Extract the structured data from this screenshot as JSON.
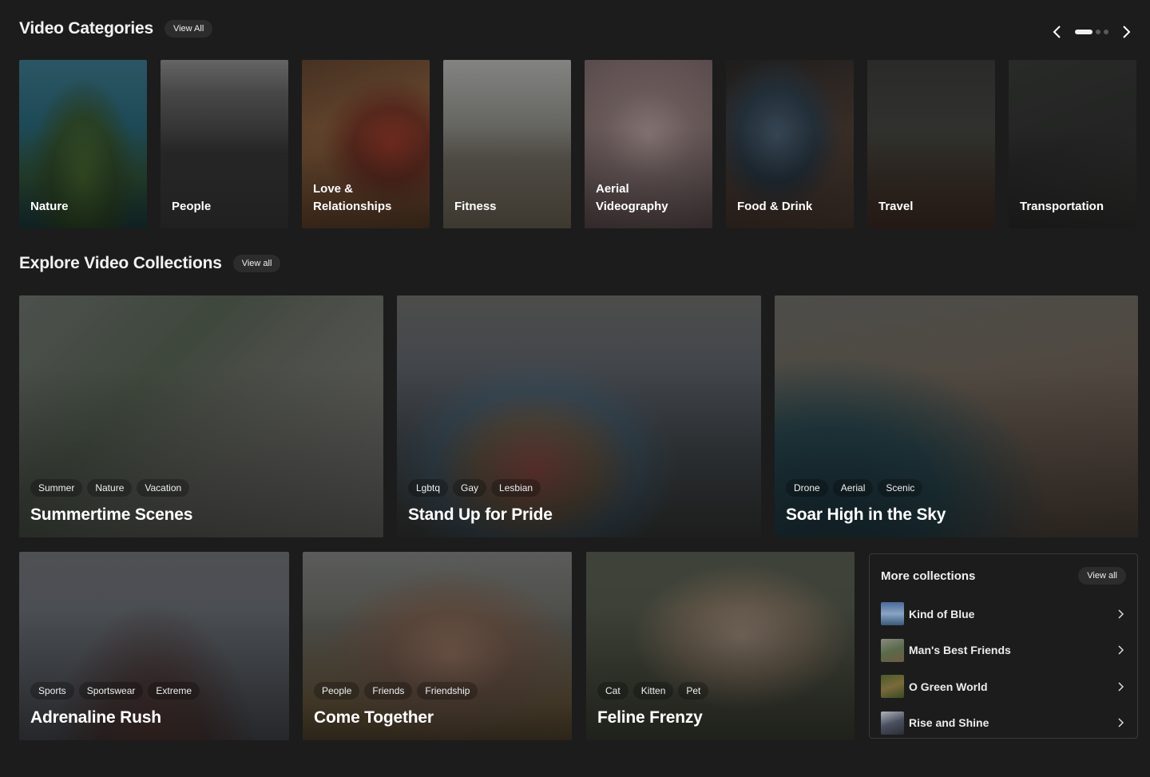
{
  "categories_section": {
    "title": "Video Categories",
    "view_all": "View All",
    "items": [
      {
        "label": "Nature"
      },
      {
        "label": "People"
      },
      {
        "label": "Love & Relationships"
      },
      {
        "label": "Fitness"
      },
      {
        "label": "Aerial Videography"
      },
      {
        "label": "Food & Drink"
      },
      {
        "label": "Travel"
      },
      {
        "label": "Transportation"
      }
    ]
  },
  "collections_section": {
    "title": "Explore Video Collections",
    "view_all": "View all",
    "cards": [
      {
        "title": "Summertime Scenes",
        "tags": [
          "Summer",
          "Nature",
          "Vacation"
        ]
      },
      {
        "title": "Stand Up for Pride",
        "tags": [
          "Lgbtq",
          "Gay",
          "Lesbian"
        ]
      },
      {
        "title": "Soar High in the Sky",
        "tags": [
          "Drone",
          "Aerial",
          "Scenic"
        ]
      },
      {
        "title": "Adrenaline Rush",
        "tags": [
          "Sports",
          "Sportswear",
          "Extreme"
        ]
      },
      {
        "title": "Come Together",
        "tags": [
          "People",
          "Friends",
          "Friendship"
        ]
      },
      {
        "title": "Feline Frenzy",
        "tags": [
          "Cat",
          "Kitten",
          "Pet"
        ]
      }
    ]
  },
  "more_collections": {
    "title": "More collections",
    "view_all": "View all",
    "items": [
      {
        "label": "Kind of Blue"
      },
      {
        "label": "Man's Best Friends"
      },
      {
        "label": "O Green World"
      },
      {
        "label": "Rise and Shine"
      }
    ]
  },
  "pager": {
    "pages": 3,
    "active": 0
  }
}
